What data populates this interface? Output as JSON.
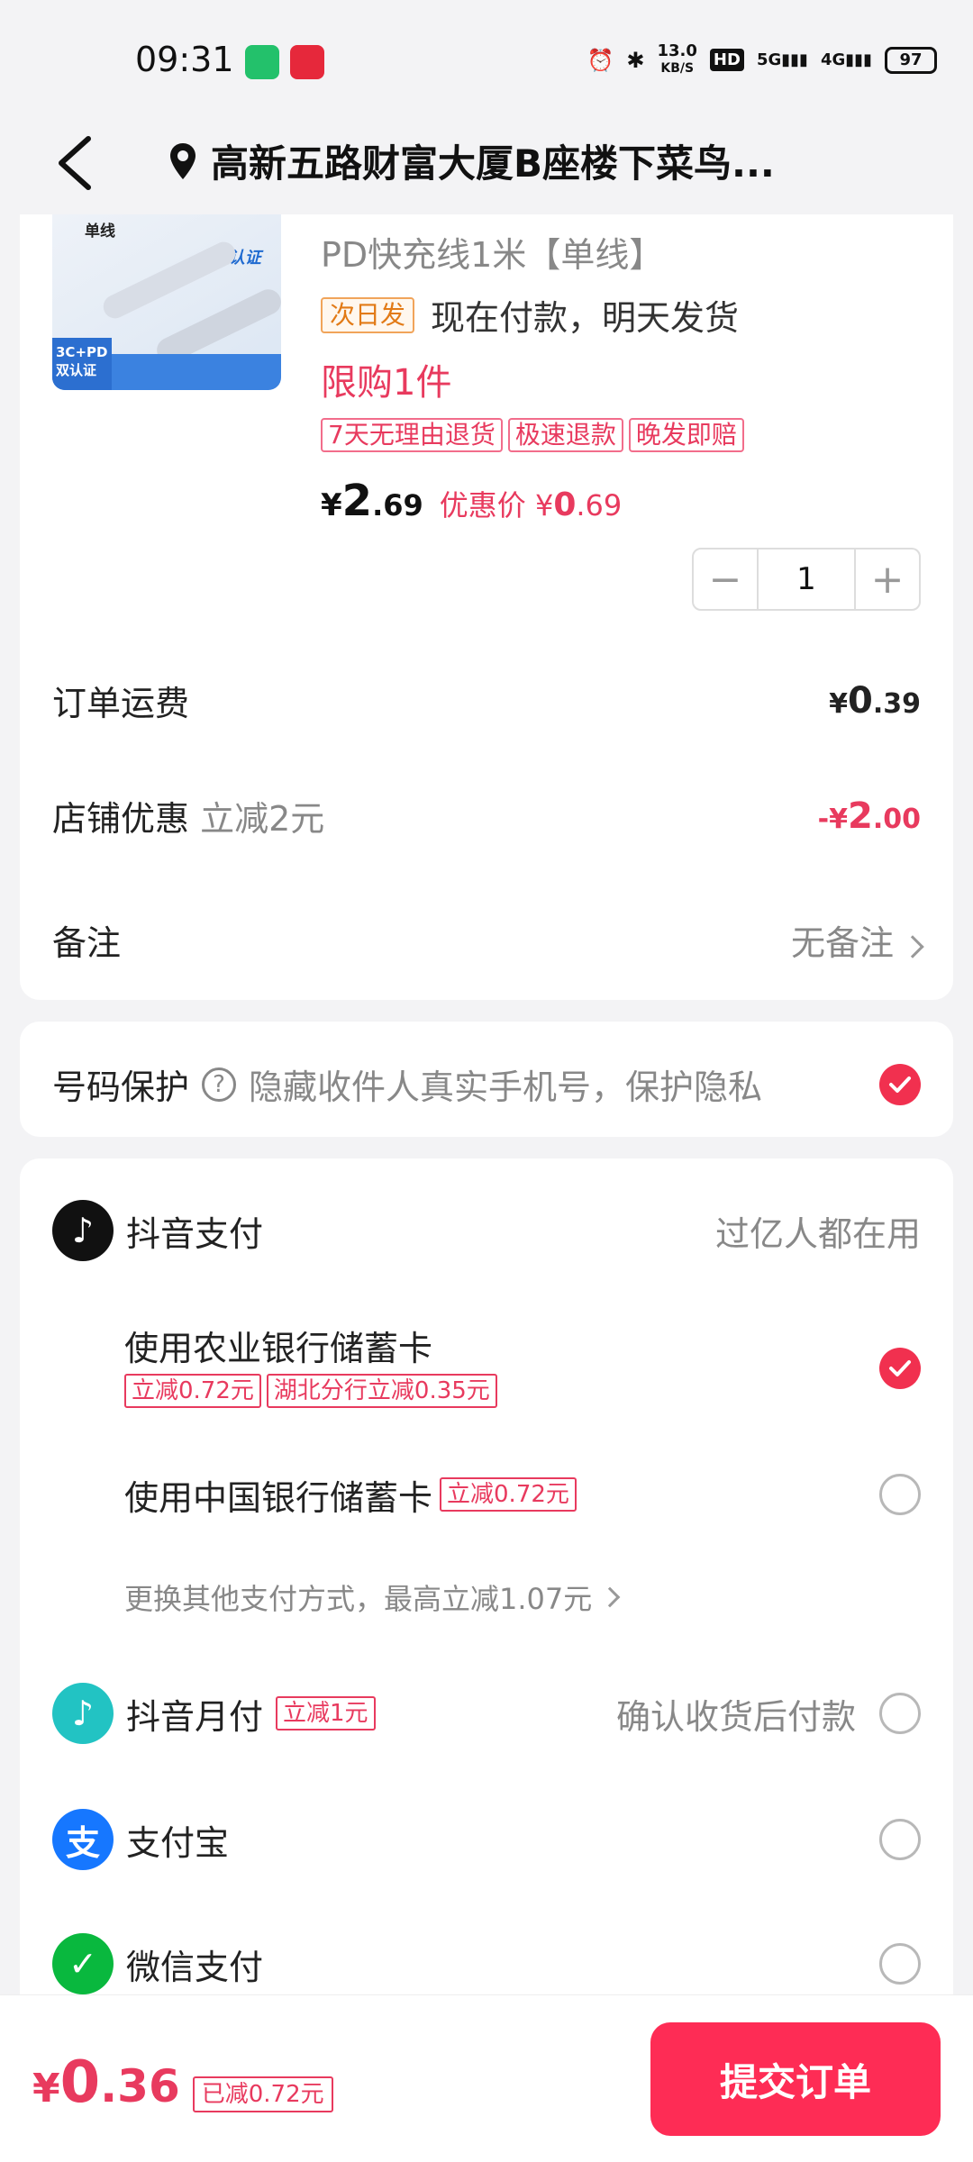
{
  "status_bar": {
    "time": "09:31",
    "net_speed_value": "13.0",
    "net_speed_unit": "KB/S",
    "hd_label": "HD",
    "sig1": "5G",
    "sig2": "4G",
    "battery": "97"
  },
  "nav": {
    "address": "高新五路财富大厦B座楼下菜鸟..."
  },
  "product": {
    "thumb_label_1": "单线",
    "thumb_label_2": "3C认证",
    "thumb_label_3": "3C+PD 双认证",
    "title": "PD快充线1米【单线】",
    "ship_tag": "次日发",
    "ship_text": "现在付款，明天发货",
    "limit": "限购1件",
    "badges": [
      "7天无理由退货",
      "极速退款",
      "晚发即赔"
    ],
    "price_symbol": "¥",
    "price_int": "2",
    "price_dec": ".69",
    "promo_label": "优惠价",
    "promo_symbol": "¥",
    "promo_int": "0",
    "promo_dec": ".69",
    "quantity": "1"
  },
  "order": {
    "shipping_label": "订单运费",
    "shipping_sym": "¥",
    "shipping_int": "0",
    "shipping_dec": ".39",
    "store_label": "店铺优惠",
    "store_detail": "立减2元",
    "store_value_prefix": "-¥",
    "store_value_int": "2",
    "store_value_dec": ".00",
    "remark_label": "备注",
    "remark_value": "无备注"
  },
  "privacy": {
    "label": "号码保护",
    "help": "?",
    "text": "隐藏收件人真实手机号，保护隐私"
  },
  "payment": {
    "douyin_pay": "抖音支付",
    "douyin_pay_note": "过亿人都在用",
    "abc_card": "使用农业银行储蓄卡",
    "abc_tags": [
      "立减0.72元",
      "湖北分行立减0.35元"
    ],
    "boc_card": "使用中国银行储蓄卡",
    "boc_tag": "立减0.72元",
    "more_methods": "更换其他支付方式，最高立减1.07元",
    "monthly": "抖音月付",
    "monthly_tag": "立减1元",
    "monthly_note": "确认收货后付款",
    "alipay": "支付宝",
    "alipay_icon": "支",
    "wechat": "微信支付"
  },
  "footer": {
    "total_sym": "¥",
    "total_int": "0",
    "total_dec": ".36",
    "saved": "已减0.72元",
    "submit": "提交订单"
  },
  "colors": {
    "accent": "#fe2c55",
    "price_red": "#e83a5e",
    "alipay": "#1677ff",
    "wechat": "#09b83e",
    "monthly": "#22c3c3"
  }
}
